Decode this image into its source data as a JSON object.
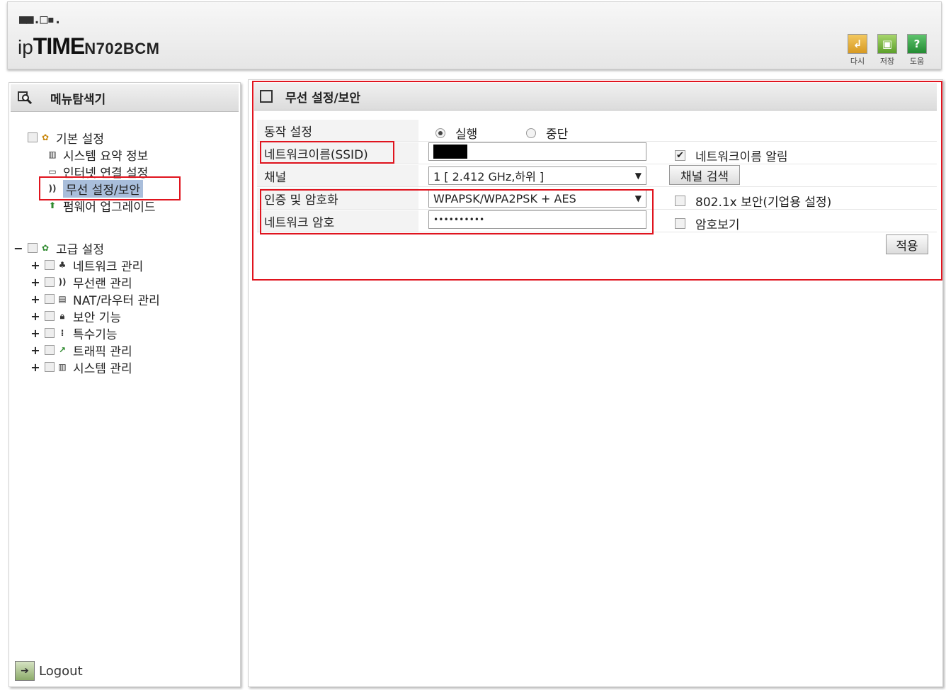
{
  "header": {
    "logo_dots": "■■.□▪.",
    "logo_ip": "ip",
    "logo_time": "TIME",
    "model": "N702BCM",
    "toolbar": [
      {
        "label": "다시",
        "icon": "refresh-icon"
      },
      {
        "label": "저장",
        "icon": "save-icon"
      },
      {
        "label": "도움",
        "icon": "help-icon"
      }
    ]
  },
  "sidebar": {
    "title": "메뉴탐색기",
    "basic": {
      "label": "기본 설정",
      "items": [
        "시스템 요약 정보",
        "인터넷 연결 설정",
        "무선 설정/보안",
        "펌웨어 업그레이드"
      ]
    },
    "advanced": {
      "label": "고급 설정",
      "collapse_symbol": "−",
      "expand_symbol": "+",
      "items": [
        "네트워크 관리",
        "무선랜 관리",
        "NAT/라우터 관리",
        "보안 기능",
        "특수기능",
        "트래픽 관리",
        "시스템 관리"
      ]
    },
    "logout": "Logout"
  },
  "main": {
    "title": "무선 설정/보안",
    "rows": {
      "operation": {
        "label": "동작 설정",
        "run": "실행",
        "stop": "중단",
        "selected": "실행"
      },
      "ssid": {
        "label": "네트워크이름(SSID)",
        "value": "",
        "broadcast_label": "네트워크이름 알림",
        "broadcast_checked": true
      },
      "channel": {
        "label": "채널",
        "value": "1 [ 2.412 GHz,하위 ]",
        "scan_button": "채널 검색"
      },
      "auth": {
        "label": "인증 및 암호화",
        "value": "WPAPSK/WPA2PSK + AES",
        "dot1x_label": "802.1x 보안(기업용 설정)",
        "dot1x_checked": false
      },
      "password": {
        "label": "네트워크 암호",
        "value": "••••••••••",
        "show_label": "암호보기",
        "show_checked": false
      }
    },
    "apply_button": "적용"
  },
  "colors": {
    "highlight_box": "#e0141e",
    "selected_bg": "#a9bedb",
    "logo_green": "#2fa94a"
  }
}
